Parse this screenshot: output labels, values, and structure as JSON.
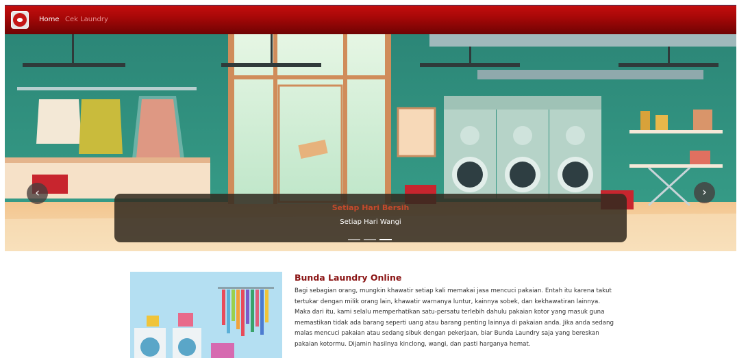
{
  "navbar": {
    "brand_icon": "laundry-logo-icon",
    "links": [
      {
        "label": "Home",
        "active": true
      },
      {
        "label": "Cek Laundry",
        "active": false
      }
    ]
  },
  "carousel": {
    "prev_icon": "chevron-left-icon",
    "next_icon": "chevron-right-icon",
    "caption_title": "Setiap Hari Bersih",
    "caption_text": "Setiap Hari Wangi",
    "slide_count": 3,
    "active_slide": 3
  },
  "about": {
    "title": "Bunda Laundry Online",
    "body": "Bagi sebagian orang, mungkin khawatir setiap kali memakai jasa mencuci pakaian. Entah itu karena takut tertukar dengan milik orang lain, khawatir warnanya luntur, kainnya sobek, dan kekhawatiran lainnya. Maka dari itu, kami selalu memperhatikan satu-persatu terlebih dahulu pakaian kotor yang masuk guna memastikan tidak ada barang seperti uang atau barang penting lainnya di pakaian anda. Jika anda sedang malas mencuci pakaian atau sedang sibuk dengan pekerjaan, biar Bunda Laundry saja yang bereskan pakaian kotormu. Dijamin hasilnya kinclong, wangi, dan pasti harganya hemat."
  },
  "colors": {
    "navbar_top": "#c40e0e",
    "navbar_bottom": "#6e0303",
    "title_red": "#8a1313",
    "caption_title": "#c64a2c"
  }
}
